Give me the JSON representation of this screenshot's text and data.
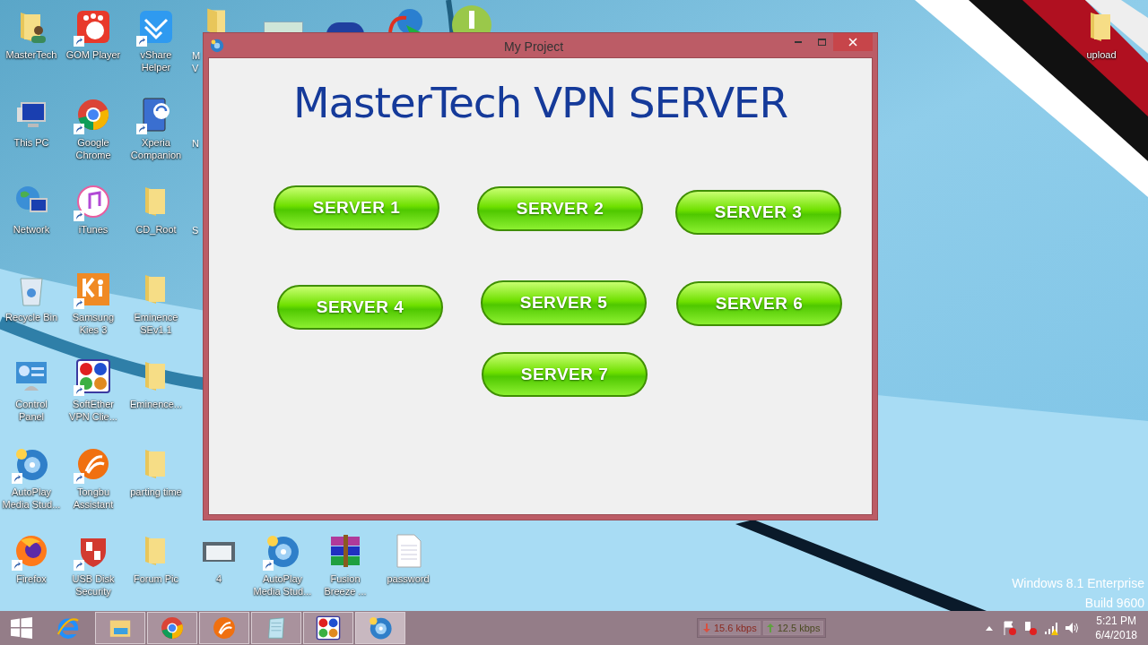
{
  "desktop": {
    "columns": [
      [
        {
          "label": "MasterTech",
          "kind": "user-folder",
          "shortcut": false
        },
        {
          "label": "This PC",
          "kind": "computer",
          "shortcut": false
        },
        {
          "label": "Network",
          "kind": "network",
          "shortcut": false
        },
        {
          "label": "Recycle Bin",
          "kind": "recycle-bin",
          "shortcut": false
        },
        {
          "label": "Control Panel",
          "kind": "control-panel",
          "shortcut": false
        },
        {
          "label": "AutoPlay Media Stud...",
          "kind": "disc",
          "shortcut": true
        },
        {
          "label": "Firefox",
          "kind": "firefox",
          "shortcut": true
        }
      ],
      [
        {
          "label": "GOM Player",
          "kind": "player",
          "shortcut": true
        },
        {
          "label": "Google Chrome",
          "kind": "chrome",
          "shortcut": true
        },
        {
          "label": "iTunes",
          "kind": "music",
          "shortcut": true
        },
        {
          "label": "Samsung Kies 3",
          "kind": "kies",
          "shortcut": true
        },
        {
          "label": "SoftEther VPN Clie...",
          "kind": "dots",
          "shortcut": true
        },
        {
          "label": "Tongbu Assistant",
          "kind": "tongbu",
          "shortcut": true
        },
        {
          "label": "USB Disk Security",
          "kind": "shield",
          "shortcut": true
        }
      ],
      [
        {
          "label": "vShare Helper",
          "kind": "vshare",
          "shortcut": true
        },
        {
          "label": "Xperia Companion",
          "kind": "phone",
          "shortcut": true
        },
        {
          "label": "CD_Root",
          "kind": "folder",
          "shortcut": false
        },
        {
          "label": "Eminence SEv1.1",
          "kind": "folder",
          "shortcut": false
        },
        {
          "label": "Eminence...",
          "kind": "folder",
          "shortcut": false
        },
        {
          "label": "parting time",
          "kind": "folder",
          "shortcut": false
        },
        {
          "label": "Forum Pic",
          "kind": "folder",
          "shortcut": false
        }
      ]
    ],
    "bottom_row": [
      {
        "label": "4",
        "kind": "thumbnail",
        "shortcut": false
      },
      {
        "label": "AutoPlay Media Stud...",
        "kind": "disc",
        "shortcut": true
      },
      {
        "label": "Fusion Breeze ...",
        "kind": "archive",
        "shortcut": false
      },
      {
        "label": "password",
        "kind": "document",
        "shortcut": false
      }
    ],
    "right_column": [
      {
        "label": "upload",
        "kind": "folder",
        "shortcut": false
      }
    ],
    "cut_labels": [
      {
        "lines": [
          "M",
          "V"
        ]
      },
      {
        "lines": [
          "N"
        ]
      },
      {
        "lines": [
          "S"
        ]
      }
    ],
    "watermark": [
      "Windows 8.1 Enterprise",
      "Build 9600"
    ]
  },
  "window": {
    "title": "My Project",
    "heading": "MasterTech VPN SERVER",
    "buttons": [
      {
        "label": "SERVER 1"
      },
      {
        "label": "SERVER 2"
      },
      {
        "label": "SERVER 3"
      },
      {
        "label": "SERVER 4"
      },
      {
        "label": "SERVER 5"
      },
      {
        "label": "SERVER 6"
      },
      {
        "label": "SERVER 7"
      }
    ]
  },
  "taskbar": {
    "items": [
      {
        "kind": "ie",
        "running": false,
        "selected": false
      },
      {
        "kind": "explorer",
        "running": true,
        "selected": false
      },
      {
        "kind": "chrome",
        "running": true,
        "selected": false
      },
      {
        "kind": "tongbu",
        "running": true,
        "selected": false
      },
      {
        "kind": "notepad",
        "running": true,
        "selected": false
      },
      {
        "kind": "dots",
        "running": true,
        "selected": false
      },
      {
        "kind": "disc",
        "running": true,
        "selected": true
      }
    ],
    "net_speed": [
      {
        "kind": "down",
        "text": "15.6 kbps"
      },
      {
        "kind": "up",
        "text": "12.5 kbps"
      }
    ],
    "time": "5:21 PM",
    "date": "6/4/2018"
  }
}
